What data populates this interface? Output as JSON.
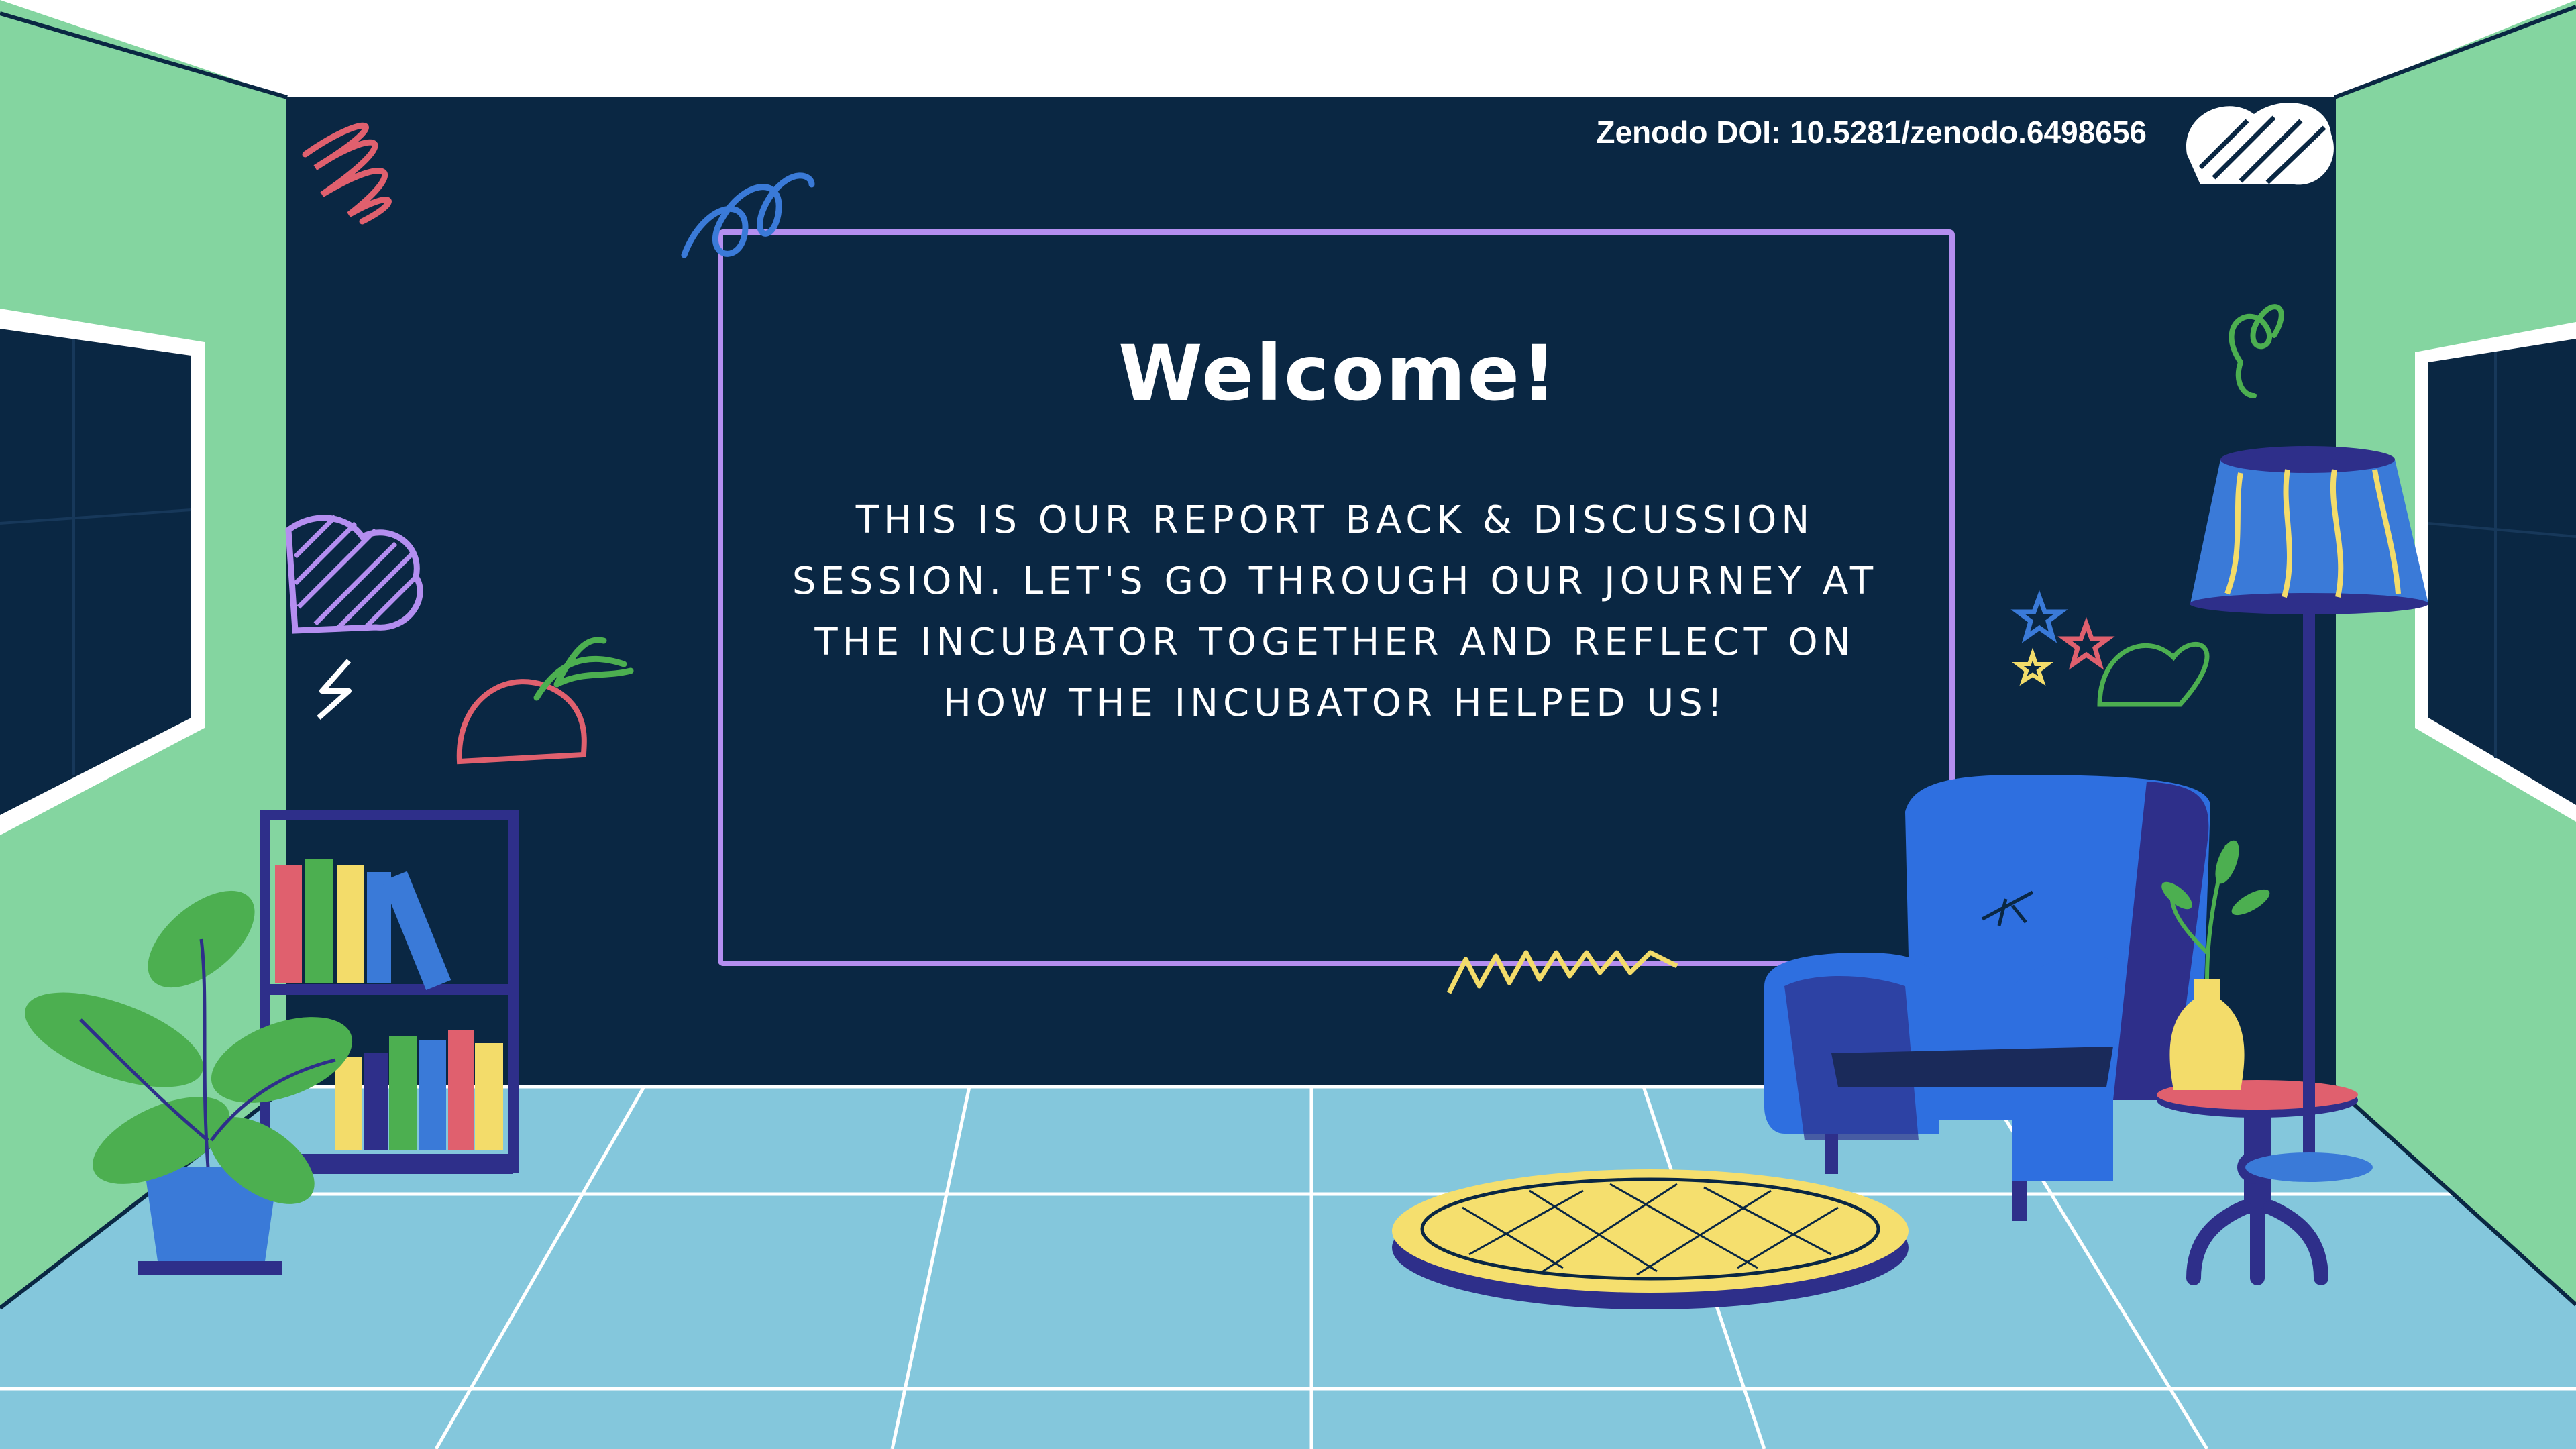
{
  "doi": "Zenodo DOI: 10.5281/zenodo.6498656",
  "welcome": {
    "title": "Welcome!",
    "lines": [
      "THIS IS OUR REPORT BACK & DISCUSSION",
      "SESSION. LET'S GO THROUGH OUR JOURNEY AT",
      "THE INCUBATOR TOGETHER AND REFLECT ON",
      "HOW THE INCUBATOR HELPED US!"
    ]
  },
  "colors": {
    "back_wall": "#0a2743",
    "side_wall": "#84d5a0",
    "floor": "#84c7dc",
    "frame_border": "#b48ef0",
    "chair": "#2e6fe0",
    "chair_shadow": "#2e2f8a",
    "rug": "#f5df6e",
    "vase": "#f3dc6a"
  },
  "icons": [
    "scribble-icon",
    "cloud-doodle-icon",
    "lightning-icon",
    "carrot-doodle-icon",
    "swirl-icon",
    "star-icon",
    "zigzag-icon",
    "bookshelf-icon",
    "potted-plant-icon",
    "armchair-icon",
    "rug-icon",
    "side-table-icon",
    "floor-lamp-icon",
    "vase-icon"
  ]
}
